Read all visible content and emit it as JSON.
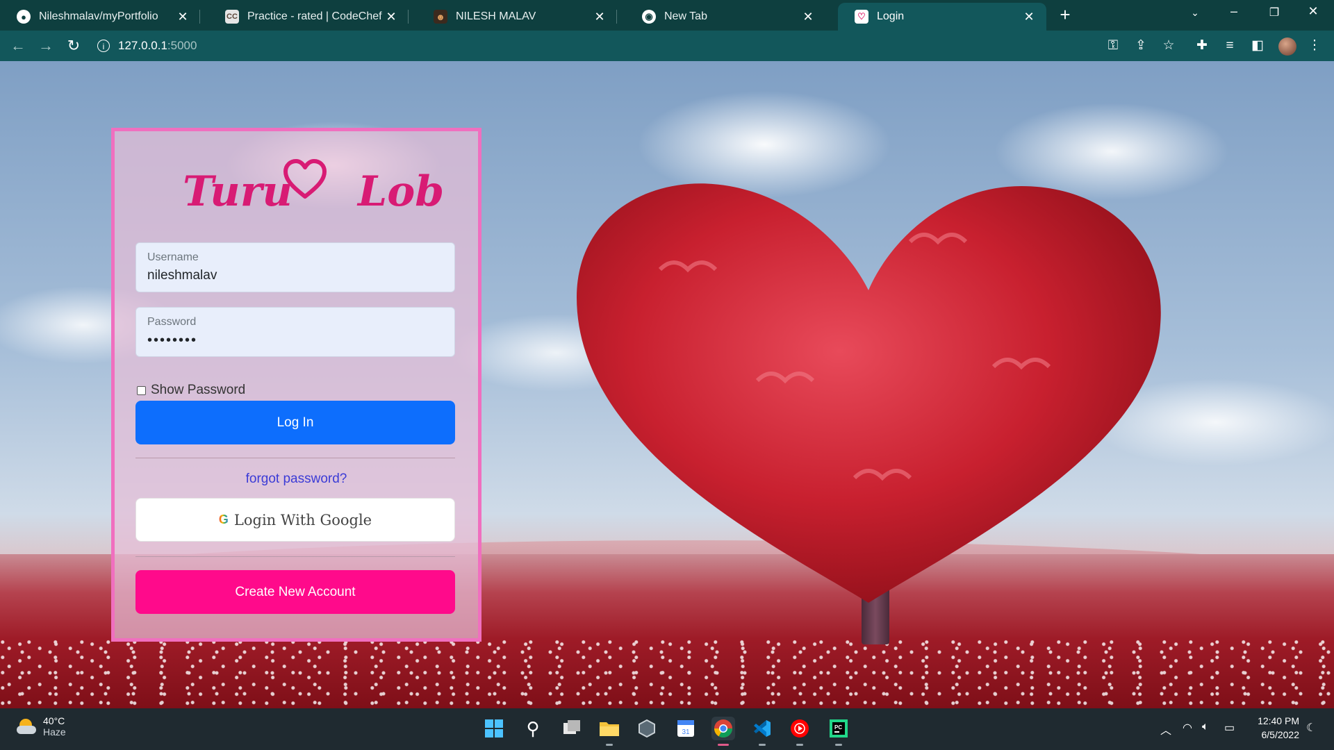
{
  "browser": {
    "tabs": [
      {
        "title": "Nileshmalav/myPortfolio",
        "icon": "github-icon",
        "active": false
      },
      {
        "title": "Practice - rated | CodeChef",
        "icon": "codechef-icon",
        "active": false
      },
      {
        "title": "NILESH MALAV",
        "icon": "portfolio-icon",
        "active": false
      },
      {
        "title": "New Tab",
        "icon": "chrome-icon",
        "active": false
      },
      {
        "title": "Login",
        "icon": "heart-icon",
        "active": true
      }
    ],
    "close_glyph": "✕",
    "new_tab_glyph": "+",
    "url_host": "127.0.0.1",
    "url_port": ":5000"
  },
  "login": {
    "brand_word1": "Turu",
    "brand_word2": "Lob",
    "username_label": "Username",
    "username_value": "nileshmalav",
    "password_label": "Password",
    "password_value": "••••••••",
    "show_password_label": "Show Password",
    "login_button": "Log In",
    "forgot_link": "forgot password?",
    "google_button": "Login With Google",
    "google_glyph": "G",
    "create_button": "Create New Account"
  },
  "taskbar": {
    "weather_temp": "40°C",
    "weather_desc": "Haze",
    "time": "12:40 PM",
    "date": "6/5/2022"
  },
  "colors": {
    "brand": "#d81b74",
    "login_button": "#0d6efd",
    "create_button": "#ff0a8b",
    "card_border": "#f06fbf"
  }
}
